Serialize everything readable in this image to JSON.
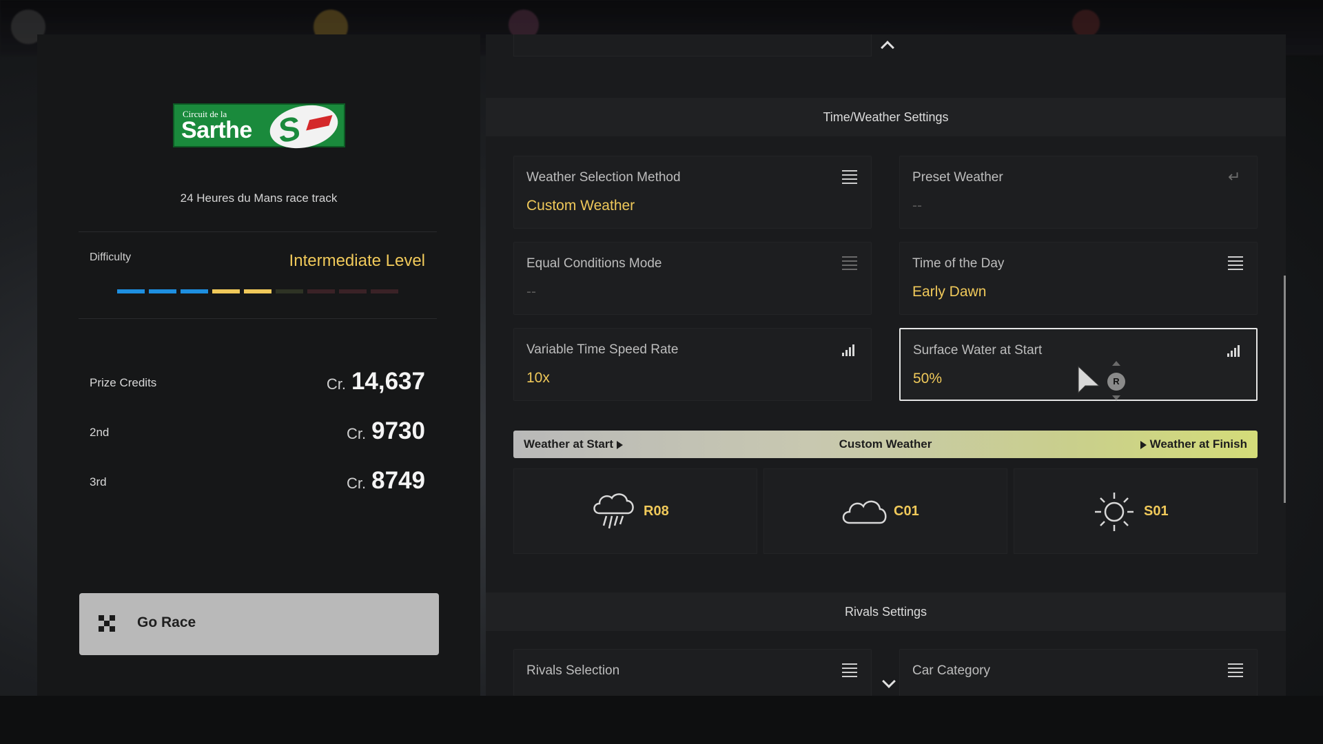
{
  "track": {
    "logo_line1": "Circuit de la",
    "logo_line2": "Sarthe",
    "subtitle": "24 Heures du Mans race track"
  },
  "difficulty": {
    "label": "Difficulty",
    "value": "Intermediate Level",
    "level": 5,
    "max_level": 9
  },
  "prizes": [
    {
      "label": "Prize Credits",
      "currency": "Cr.",
      "amount": "14,637"
    },
    {
      "label": "2nd",
      "currency": "Cr.",
      "amount": "9730"
    },
    {
      "label": "3rd",
      "currency": "Cr.",
      "amount": "8749"
    }
  ],
  "go_race": {
    "label": "Go Race"
  },
  "time_weather": {
    "section_title": "Time/Weather Settings",
    "cards": [
      {
        "title": "Weather Selection Method",
        "value": "Custom Weather",
        "icon": "menu-icon"
      },
      {
        "title": "Preset Weather",
        "value": "--",
        "icon": "enter-icon"
      },
      {
        "title": "Equal Conditions Mode",
        "value": "--",
        "icon": "menu-icon"
      },
      {
        "title": "Time of the Day",
        "value": "Early Dawn",
        "icon": "menu-icon"
      },
      {
        "title": "Variable Time Speed Rate",
        "value": "10x",
        "icon": "bars-icon"
      },
      {
        "title": "Surface Water at Start",
        "value": "50%",
        "icon": "bars-icon"
      }
    ],
    "weather_band": {
      "start": "Weather at Start",
      "center": "Custom Weather",
      "finish": "Weather at Finish"
    },
    "weather_tiles": [
      {
        "code": "R08",
        "icon": "rain-cloud-icon"
      },
      {
        "code": "C01",
        "icon": "cloud-icon"
      },
      {
        "code": "S01",
        "icon": "sun-icon"
      }
    ]
  },
  "rivals": {
    "section_title": "Rivals Settings",
    "cards": [
      {
        "title": "Rivals Selection",
        "icon": "menu-icon"
      },
      {
        "title": "Car Category",
        "icon": "menu-icon"
      }
    ]
  },
  "cursor_badge": "R",
  "colors": {
    "accent_gold": "#f0c95a",
    "difficulty_blue": "#1e8fe0",
    "difficulty_yellow": "#f0c95a"
  }
}
